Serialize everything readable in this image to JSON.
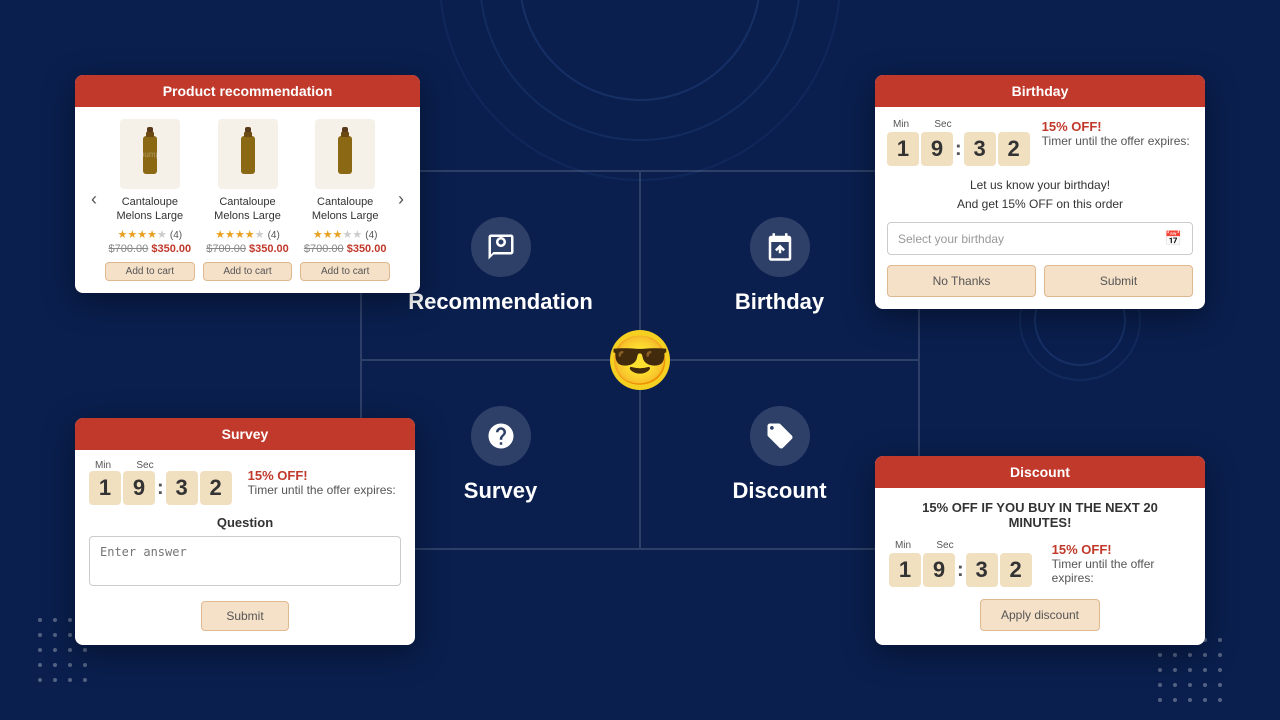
{
  "background": {
    "color": "#0a1f4e"
  },
  "recommendation_card": {
    "title": "Product recommendation",
    "products": [
      {
        "name": "Cantaloupe Melons Large",
        "rating": "★★★★☆",
        "review_count": "(4)",
        "price_old": "$700.00",
        "price_new": "$350.00",
        "add_label": "Add to cart"
      },
      {
        "name": "Cantaloupe Melons Large",
        "rating": "★★★★☆",
        "review_count": "(4)",
        "price_old": "$700.00",
        "price_new": "$350.00",
        "add_label": "Add to cart"
      },
      {
        "name": "Cantaloupe Melons Large",
        "rating": "★★★☆☆",
        "review_count": "(4)",
        "price_old": "$700.00",
        "price_new": "$350.00",
        "add_label": "Add to cart"
      }
    ]
  },
  "birthday_card": {
    "title": "Birthday",
    "timer": {
      "min_label": "Min",
      "sec_label": "Sec",
      "d1": "1",
      "d2": "9",
      "d3": "3",
      "d4": "2"
    },
    "off_text": "15% OFF!",
    "expire_text": "Timer until the offer expires:",
    "message1": "Let us know your birthday!",
    "message2": "And get 15% OFF on this order",
    "input_placeholder": "Select your birthday",
    "no_thanks": "No Thanks",
    "submit": "Submit"
  },
  "survey_card": {
    "title": "Survey",
    "timer": {
      "min_label": "Min",
      "sec_label": "Sec",
      "d1": "1",
      "d2": "9",
      "d3": "3",
      "d4": "2"
    },
    "off_text": "15% OFF!",
    "expire_text": "Timer until the offer expires:",
    "question_label": "Question",
    "input_placeholder": "Enter answer",
    "submit_label": "Submit"
  },
  "discount_card": {
    "title": "Discount",
    "headline": "15% OFF IF YOU BUY IN THE NEXT 20 MINUTES!",
    "timer": {
      "min_label": "Min",
      "sec_label": "Sec",
      "d1": "1",
      "d2": "9",
      "d3": "3",
      "d4": "2"
    },
    "off_text": "15% OFF!",
    "expire_text": "Timer until the offer expires:",
    "apply_label": "Apply discount"
  },
  "quadrants": {
    "recommendation": {
      "label": "Recommendation"
    },
    "birthday": {
      "label": "Birthday"
    },
    "survey": {
      "label": "Survey"
    },
    "discount": {
      "label": "Discount"
    }
  }
}
